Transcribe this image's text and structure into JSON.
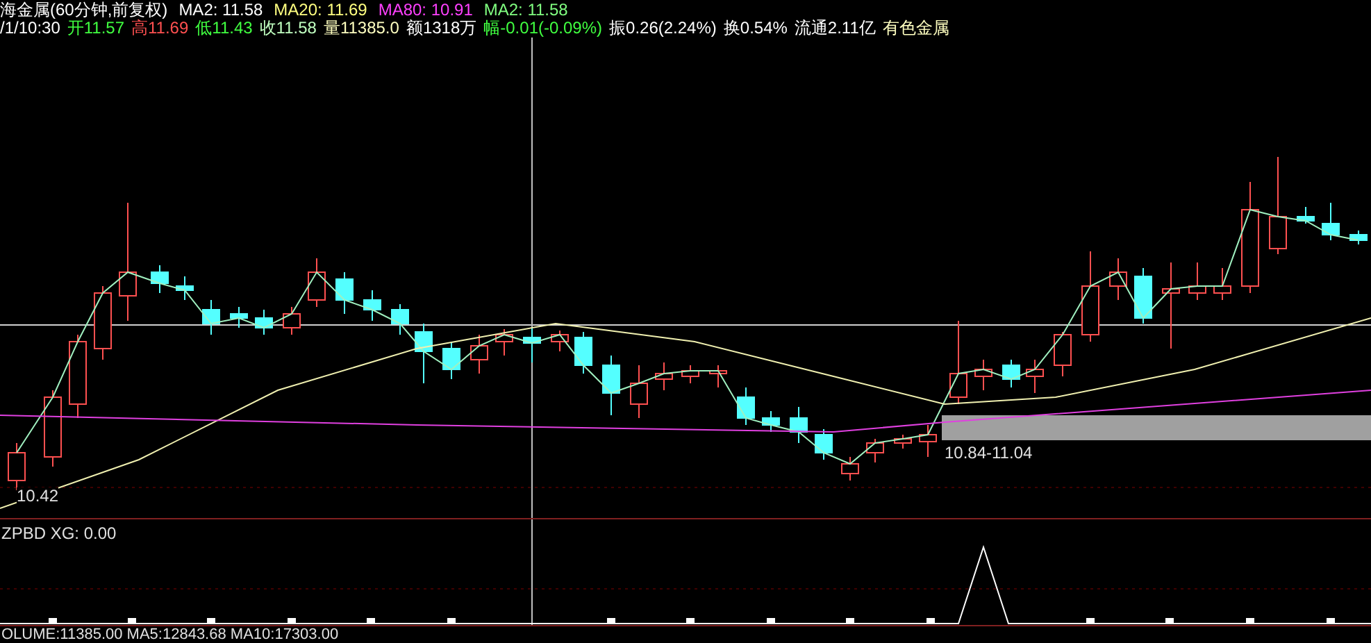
{
  "header": {
    "line_1": [
      {
        "text": "海金属(60分钟,前复权)",
        "color": "#ffffff"
      },
      {
        "text": "MA2: 11.58",
        "color": "#ffffff"
      },
      {
        "text": "MA20: 11.69",
        "color": "#ffff80"
      },
      {
        "text": "MA80: 10.91",
        "color": "#ff40ff"
      },
      {
        "text": "MA2: 11.58",
        "color": "#80ff80"
      }
    ],
    "line_2": [
      {
        "text": "/1/10:30",
        "color": "#ffffff"
      },
      {
        "text": "开11.57",
        "color": "#40ff40"
      },
      {
        "text": "高11.69",
        "color": "#ff5050"
      },
      {
        "text": "低11.43",
        "color": "#40ff40"
      },
      {
        "text": "收11.58",
        "color": "#c0ffc0"
      },
      {
        "text": "量11385.0",
        "color": "#ffffc0"
      },
      {
        "text": "额1318万",
        "color": "#ffffff"
      },
      {
        "text": "幅-0.01(-0.09%)",
        "color": "#40ff40"
      },
      {
        "text": "振0.26(2.24%)",
        "color": "#ffffff"
      },
      {
        "text": "换0.54%",
        "color": "#ffffff"
      },
      {
        "text": "流通2.11亿",
        "color": "#ffffff"
      },
      {
        "text": "有色金属",
        "color": "#ffffc0"
      }
    ]
  },
  "price_chart": {
    "low_label": "10.42",
    "range_label": "10.84-11.04"
  },
  "indicator": {
    "label": "ZPBD XG: 0.00"
  },
  "bottom_readout": "OLUME:11385.00 MA5:12843.68 MA10:17303.00"
}
